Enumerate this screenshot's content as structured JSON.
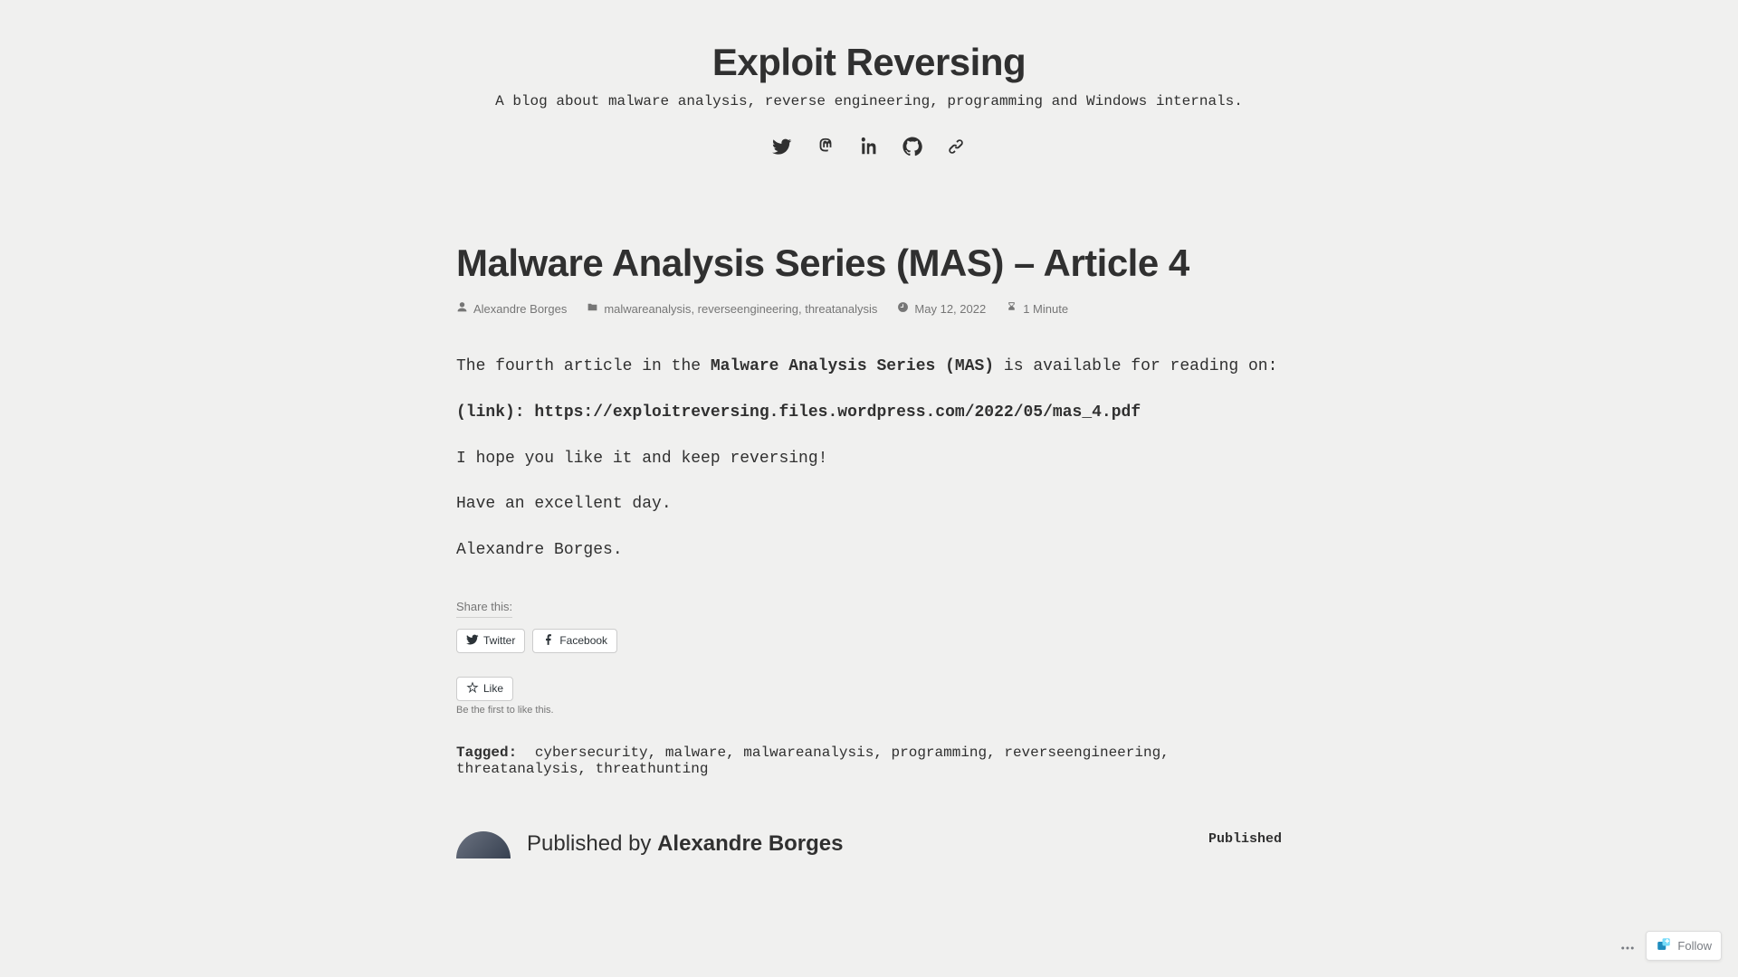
{
  "header": {
    "title": "Exploit Reversing",
    "tagline": "A blog about malware analysis, reverse engineering, programming and Windows internals."
  },
  "article": {
    "title": "Malware Analysis Series (MAS) – Article 4",
    "meta": {
      "author": "Alexandre Borges",
      "categories": [
        "malwareanalysis",
        "reverseengineering",
        "threatanalysis"
      ],
      "date": "May 12, 2022",
      "read_time": "1 Minute"
    },
    "body": {
      "p1_a": "The fourth article in the ",
      "p1_b": "Malware Analysis Series (MAS)",
      "p1_c": " is available for reading on:",
      "p2_a": "(link): ",
      "p2_b": "https://exploitreversing.files.wordpress.com/2022/05/mas_4.pdf",
      "p3": "I hope you like it and keep reversing!",
      "p4": "Have an excellent day.",
      "p5": "Alexandre Borges."
    },
    "share": {
      "heading": "Share this:",
      "twitter": "Twitter",
      "facebook": "Facebook"
    },
    "like": {
      "button": "Like",
      "caption": "Be the first to like this."
    },
    "tags_label": "Tagged:",
    "tags": [
      "cybersecurity",
      "malware",
      "malwareanalysis",
      "programming",
      "reverseengineering",
      "threatanalysis",
      "threathunting"
    ],
    "author_block": {
      "prefix": "Published by ",
      "name": "Alexandre Borges",
      "published_label": "Published"
    }
  },
  "follow_widget": {
    "label": "Follow"
  }
}
